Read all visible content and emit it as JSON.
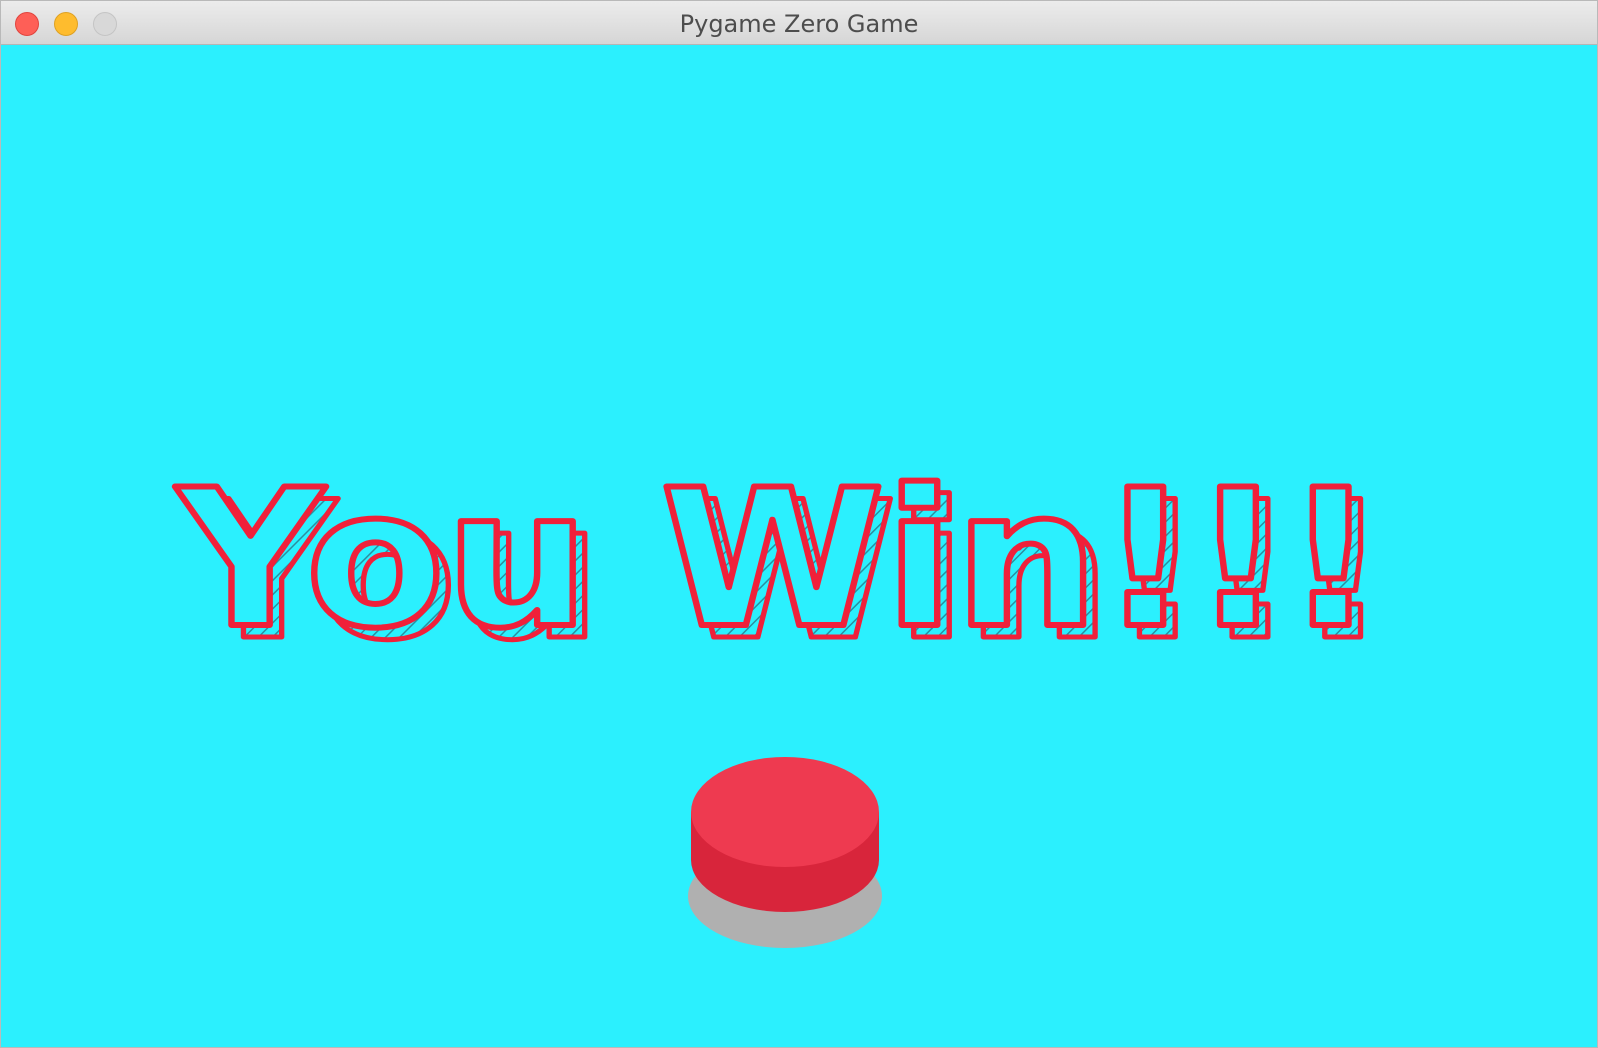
{
  "window": {
    "title": "Pygame Zero Game"
  },
  "game": {
    "message": "You Win!!!",
    "background_color": "#2bf0fe",
    "text_color": "#f0203a"
  },
  "button": {
    "name": "red-push-button",
    "top_color": "#ee3a50",
    "side_color": "#d8253b",
    "shadow_color": "#b0b0b0"
  }
}
